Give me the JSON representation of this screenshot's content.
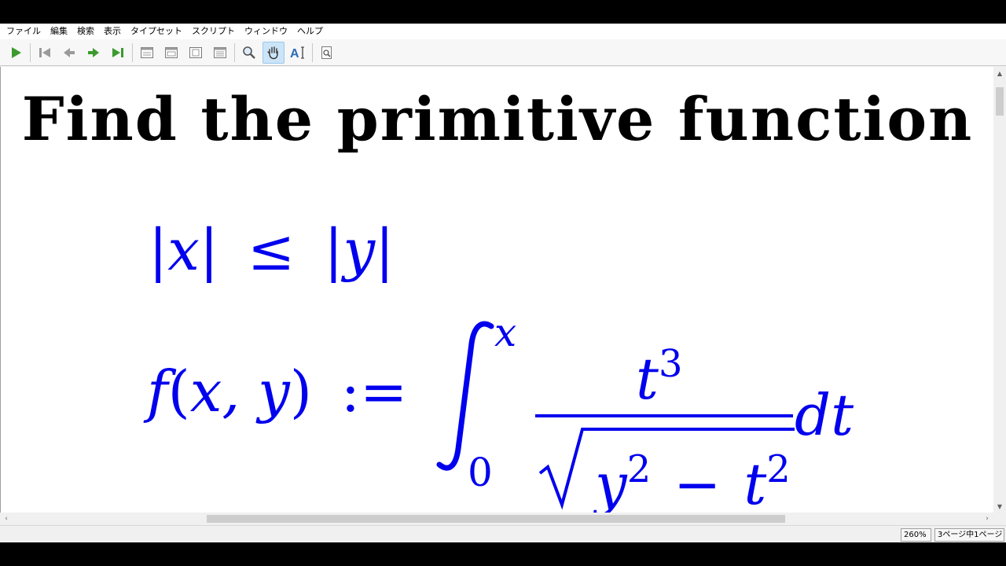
{
  "menu": [
    "ファイル",
    "編集",
    "検索",
    "表示",
    "タイプセット",
    "スクリプト",
    "ウィンドウ",
    "ヘルプ"
  ],
  "toolbar": {
    "icons": [
      "typeset-run-icon",
      "first-page-icon",
      "previous-page-icon",
      "next-page-icon",
      "last-page-icon",
      "single-page-icon",
      "continuous-page-icon",
      "facing-pages-icon",
      "fit-width-icon",
      "magnify-icon",
      "hand-tool-icon",
      "text-select-icon",
      "find-icon"
    ],
    "active": "hand-tool-icon",
    "accent": "#3c9a2e"
  },
  "document": {
    "title": "Find the primitive function",
    "condition": {
      "lhs": "x",
      "op": "≤",
      "rhs": "y"
    },
    "definition": {
      "fn": "f",
      "args": "x, y",
      "assign": ":=",
      "integral_upper": "x",
      "integral_lower": "0",
      "numerator_base": "t",
      "numerator_exp": "3",
      "radicand_a": "y",
      "radicand_a_exp": "2",
      "minus": "−",
      "radicand_b": "t",
      "radicand_b_exp": "2",
      "differential": "dt"
    },
    "math_color": "#0000ee"
  },
  "status": {
    "zoom": "260%",
    "page": "3ページ中1ページ"
  }
}
